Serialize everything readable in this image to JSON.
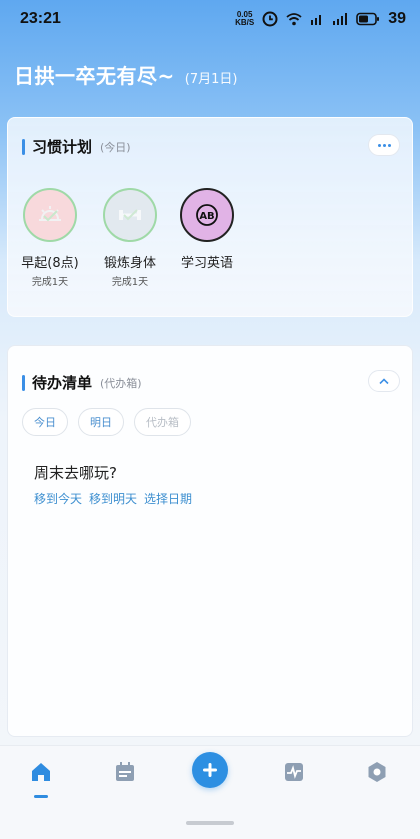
{
  "status_bar": {
    "time": "23:21",
    "speed_value": "0.05",
    "speed_unit": "KB/S",
    "battery_level": "39"
  },
  "header": {
    "title": "日拱一卒无有尽~",
    "date": "(7月1日)"
  },
  "habit_card": {
    "title": "习惯计划",
    "subtitle": "(今日)",
    "more_icon": "more-dots-icon",
    "items": [
      {
        "name": "早起(8点)",
        "stat": "完成1天",
        "icon": "sunrise-icon",
        "done": true,
        "color": "#f8d9dc"
      },
      {
        "name": "锻炼身体",
        "stat": "完成1天",
        "icon": "dumbbell-icon",
        "done": true,
        "color": "#e2e9ef"
      },
      {
        "name": "学习英语",
        "stat": "",
        "icon": "ab-letters-icon",
        "done": false,
        "color": "#e1b3e6"
      }
    ]
  },
  "todo_card": {
    "title": "待办清单",
    "subtitle": "(代办箱)",
    "collapse_icon": "chevron-up-icon",
    "chips": [
      "今日",
      "明日",
      "代办箱"
    ],
    "items": [
      {
        "text": "周末去哪玩?",
        "actions": [
          "移到今天",
          "移到明天",
          "选择日期"
        ]
      }
    ]
  },
  "bottom_nav": {
    "items": [
      "home-icon",
      "calendar-icon",
      "add-icon",
      "activity-icon",
      "settings-icon"
    ],
    "active": "home-icon"
  },
  "colors": {
    "accent": "#2d8fe2",
    "link": "#3d8fd0"
  }
}
